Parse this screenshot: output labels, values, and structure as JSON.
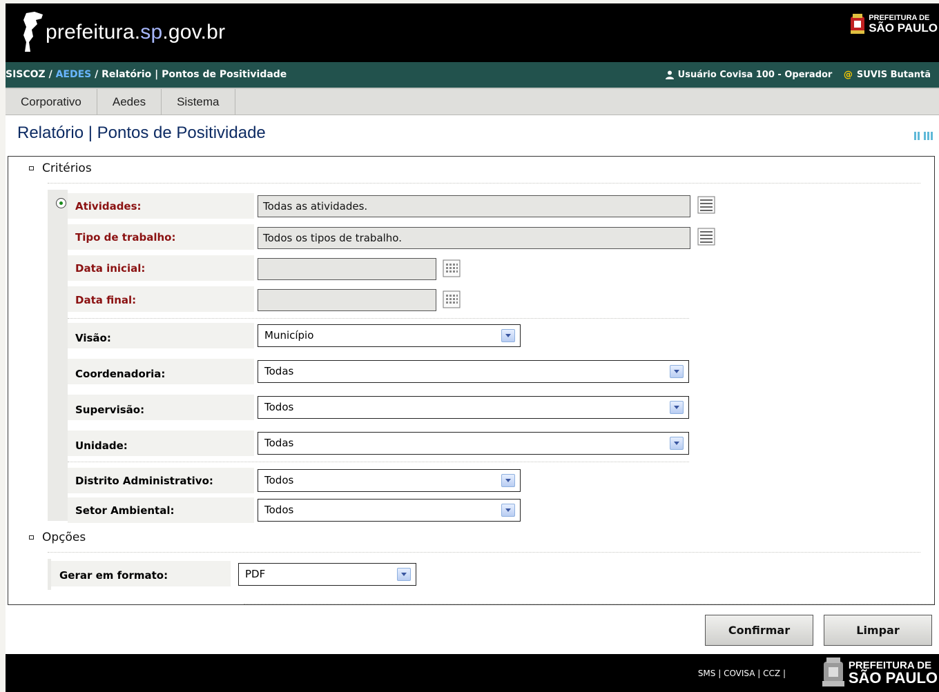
{
  "header": {
    "site_name_prefix": "prefeitura.",
    "site_name_highlight": "sp",
    "site_name_suffix": ".gov.br",
    "brand_line1": "PREFEITURA DE",
    "brand_line2": "SÃO PAULO"
  },
  "breadcrumb": {
    "root": "SISCOZ",
    "sep": " / ",
    "module": "AEDES",
    "current": "Relatório | Pontos de Positividade"
  },
  "user": {
    "name": "Usuário Covisa 100 - Operador",
    "at": "@",
    "unit": "SUVIS Butantã"
  },
  "menu": {
    "items": [
      "Corporativo",
      "Aedes",
      "Sistema"
    ]
  },
  "page": {
    "title": "Relatório | Pontos de Positividade"
  },
  "criteria": {
    "heading": "Critérios",
    "atividades_label": "Atividades:",
    "atividades_value": "Todas as atividades.",
    "tipo_label": "Tipo de trabalho:",
    "tipo_value": "Todos os tipos de trabalho.",
    "data_inicial_label": "Data inicial:",
    "data_inicial_value": "",
    "data_final_label": "Data final:",
    "data_final_value": "",
    "visao_label": "Visão:",
    "visao_value": "Município",
    "coordenadoria_label": "Coordenadoria:",
    "coordenadoria_value": "Todas",
    "supervisao_label": "Supervisão:",
    "supervisao_value": "Todos",
    "unidade_label": "Unidade:",
    "unidade_value": "Todas",
    "distrito_label": "Distrito Administrativo:",
    "distrito_value": "Todos",
    "setor_label": "Setor Ambiental:",
    "setor_value": "Todos"
  },
  "options": {
    "heading": "Opções",
    "formato_label": "Gerar em formato:",
    "formato_value": "PDF"
  },
  "buttons": {
    "confirm": "Confirmar",
    "clear": "Limpar"
  },
  "footer": {
    "links": "SMS | COVISA | CCZ |",
    "brand_line1": "PREFEITURA DE",
    "brand_line2": "SÃO PAULO"
  },
  "colors": {
    "breadcrumb_bar": "#22524d",
    "required_label": "#8b1212",
    "title": "#0d2b63",
    "highlight": "#69b6ff"
  },
  "icons": {
    "list_picker": "list-picker-icon",
    "calendar": "calendar-icon",
    "user": "user-icon",
    "dropdown": "chevron-down-icon"
  }
}
